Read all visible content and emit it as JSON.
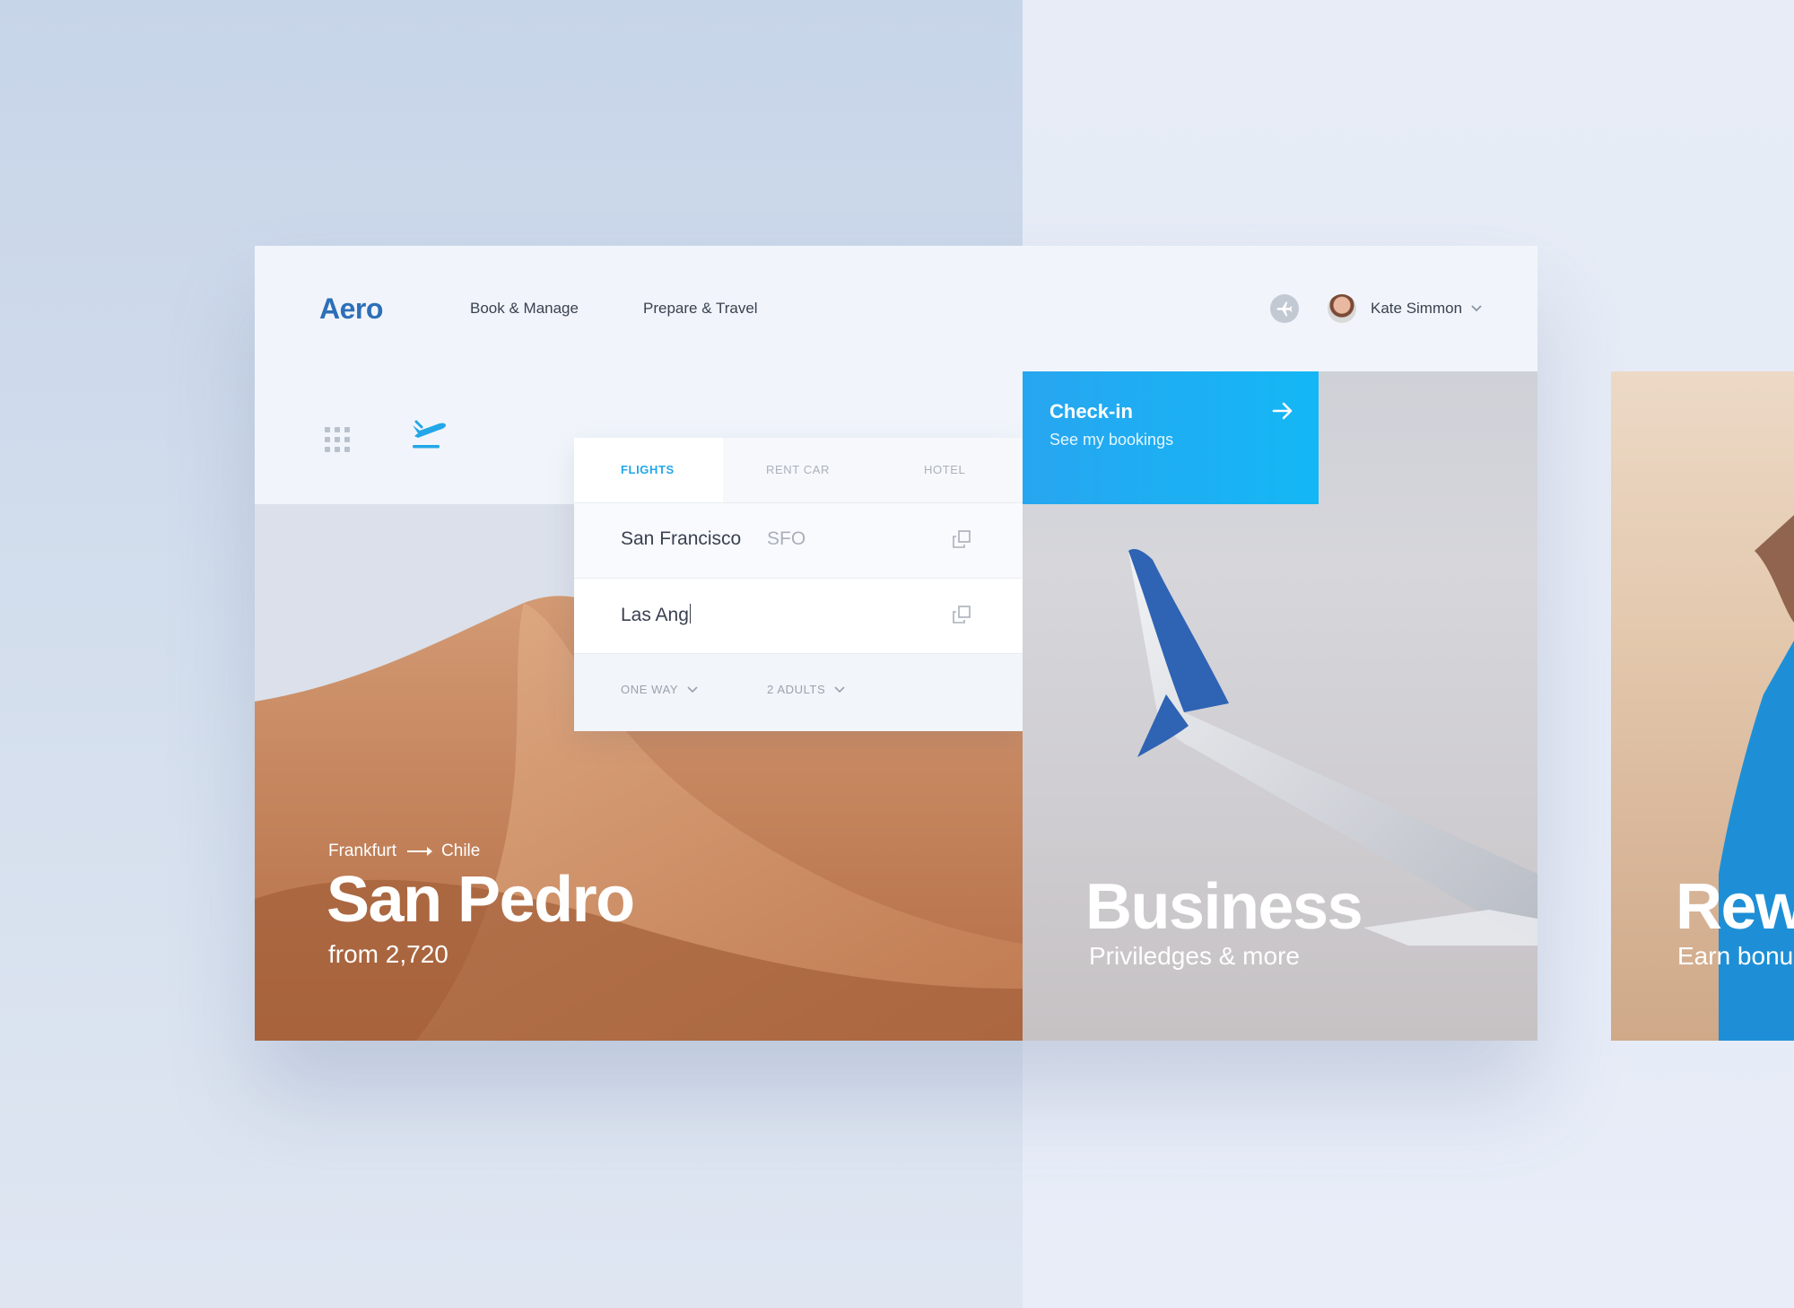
{
  "brand": {
    "logo": "Aero",
    "accent": "#2d6fb8",
    "highlight": "#23a7e8"
  },
  "nav": {
    "items": [
      {
        "label": "Book & Manage"
      },
      {
        "label": "Prepare & Travel"
      }
    ]
  },
  "user": {
    "name": "Kate Simmon"
  },
  "icons": {
    "status": "airplane-icon",
    "user_menu": "chevron-down-icon",
    "apps": "grid-icon",
    "flights": "flight-takeoff-icon",
    "swap": "copy-swap-icon",
    "checkin": "arrow-right-icon"
  },
  "search": {
    "tabs": [
      {
        "label": "FLIGHTS"
      },
      {
        "label": "RENT CAR"
      },
      {
        "label": "HOTEL"
      }
    ],
    "active_tab": "FLIGHTS",
    "from": {
      "city": "San Francisco",
      "code": "SFO"
    },
    "to": {
      "value": "Las Ang"
    },
    "options": {
      "trip": "ONE WAY",
      "passengers": "2 ADULTS"
    }
  },
  "hero": {
    "route_from": "Frankfurt",
    "route_to": "Chile",
    "title": "San Pedro",
    "price": "from 2,720"
  },
  "checkin": {
    "title": "Check-in",
    "subtitle": "See my bookings",
    "color": "#1bb0f2"
  },
  "business": {
    "title": "Business",
    "subtitle": "Priviledges & more"
  },
  "peek": {
    "title": "Rew",
    "subtitle": "Earn bonu"
  }
}
